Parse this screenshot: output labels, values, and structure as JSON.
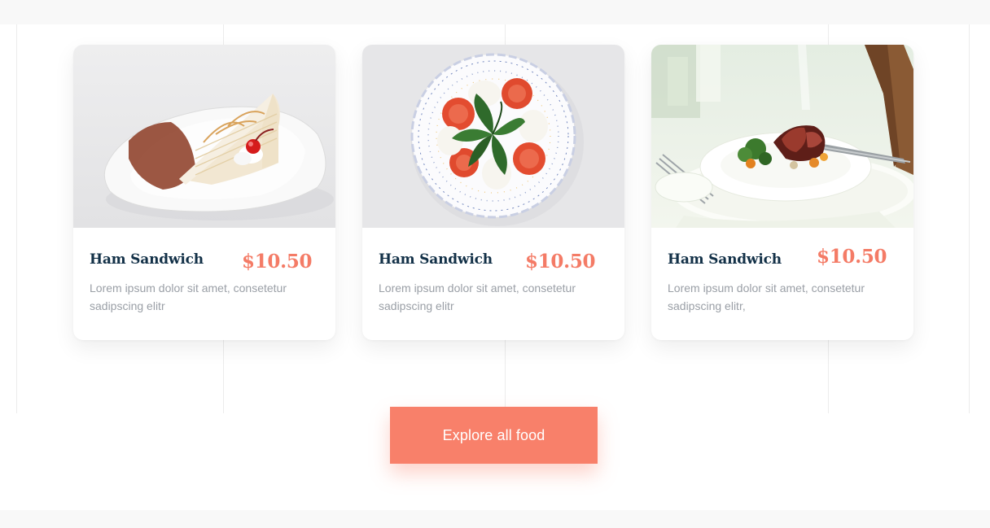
{
  "menu": {
    "cards": [
      {
        "title": "Ham Sandwich",
        "price": "$10.50",
        "description": "Lorem ipsum dolor sit amet, consetetur sadipscing elitr",
        "image": "cake-slice-photo"
      },
      {
        "title": "Ham Sandwich",
        "price": "$10.50",
        "description": "Lorem ipsum dolor sit amet, consetetur sadipscing elitr",
        "image": "caprese-salad-photo"
      },
      {
        "title": "Ham Sandwich",
        "price": "$10.50",
        "description": "Lorem ipsum dolor sit amet, consetetur sadipscing elitr,",
        "image": "steak-plate-photo"
      }
    ]
  },
  "cta": {
    "label": "Explore all food"
  },
  "colors": {
    "accent": "#f8806a",
    "title": "#123047",
    "price": "#f47b66",
    "body_text": "#9a9fa6"
  }
}
